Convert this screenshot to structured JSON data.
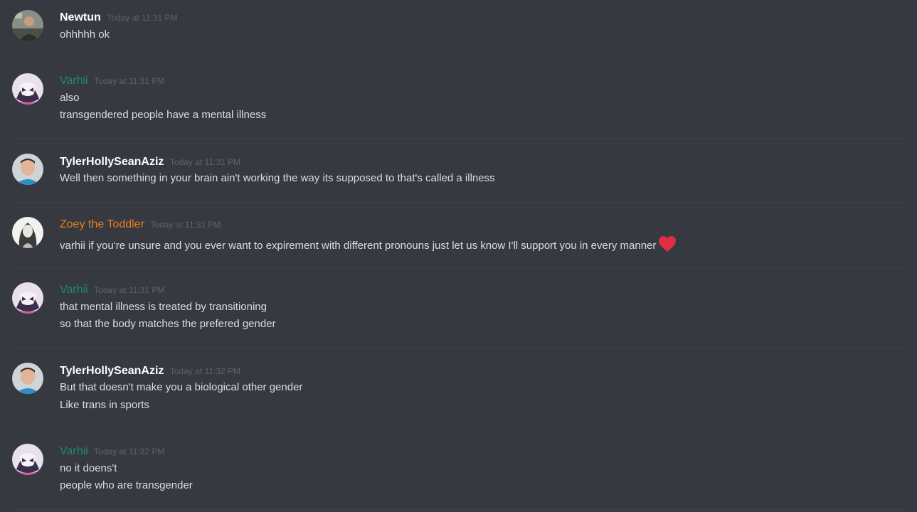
{
  "messages": [
    {
      "author": "Newtun",
      "timestamp": "Today at 11:31 PM",
      "lines": [
        "ohhhhh ok"
      ]
    },
    {
      "author": "Varhii",
      "timestamp": "Today at 11:31 PM",
      "lines": [
        "also",
        "transgendered people have a mental illness"
      ]
    },
    {
      "author": "TylerHollySeanAziz",
      "timestamp": "Today at 11:31 PM",
      "lines": [
        "Well then something in your brain ain't working the way its supposed to that's called a illness"
      ]
    },
    {
      "author": "Zoey the Toddler",
      "timestamp": "Today at 11:31 PM",
      "lines": [
        "varhii if you're unsure and you ever want to expirement with different pronouns just let us know I'll support you in every manner"
      ],
      "emoji": "heart-emoji"
    },
    {
      "author": "Varhii",
      "timestamp": "Today at 11:31 PM",
      "lines": [
        "that mental illness is treated by transitioning",
        "so that the body matches the prefered gender"
      ]
    },
    {
      "author": "TylerHollySeanAziz",
      "timestamp": "Today at 11:32 PM",
      "lines": [
        "But that doesn't make you a biological other gender",
        "Like trans in sports"
      ]
    },
    {
      "author": "Varhii",
      "timestamp": "Today at 11:32 PM",
      "lines": [
        "no it doens't",
        "people who are transgender"
      ]
    }
  ],
  "colors": {
    "background": "#36393f",
    "text": "#dcddde",
    "username_default": "#ffffff",
    "username_varhii": "#1f8b6f",
    "username_zoey": "#e67e22",
    "timestamp": "#5f6268",
    "heart": "#dd2e44"
  }
}
